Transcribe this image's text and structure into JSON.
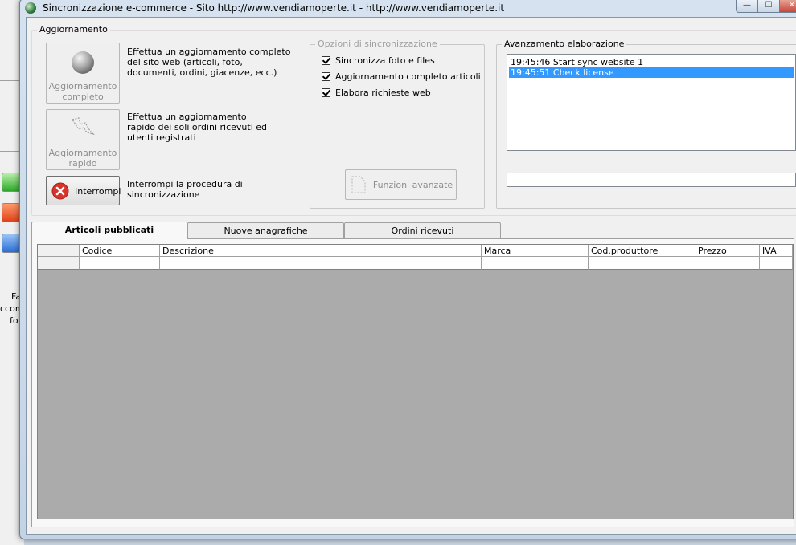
{
  "window": {
    "title": "Sincronizzazione e-commerce - Sito http://www.vendiamoperte.it - http://www.vendiamoperte.it",
    "min_glyph": "—",
    "max_glyph": "☐",
    "close_glyph": "✕"
  },
  "background_app": {
    "lines": [
      "Fa",
      "ccomp",
      "fo"
    ]
  },
  "aggiornamento": {
    "group_title": "Aggiornamento",
    "full_update": {
      "label_line1": "Aggiornamento",
      "label_line2": "completo",
      "desc_line1": "Effettua un aggiornamento completo",
      "desc_line2": "del sito web (articoli, foto,",
      "desc_line3": "documenti, ordini, giacenze, ecc.)",
      "icon": "globe-icon"
    },
    "quick_update": {
      "label_line1": "Aggiornamento",
      "label_line2": "rapido",
      "desc_line1": "Effettua un aggiornamento",
      "desc_line2": "rapido dei soli ordini ricevuti ed",
      "desc_line3": "utenti registrati",
      "icon": "lightning-icon"
    },
    "stop": {
      "label": "Interrompi",
      "desc_line1": "Interrompi la procedura di",
      "desc_line2": "sincronizzazione",
      "icon": "stop-x-icon",
      "icon_color": "#d9342b"
    }
  },
  "opzioni": {
    "group_title": "Opzioni di sincronizzazione",
    "options": [
      {
        "label": "Sincronizza foto e files",
        "checked": true
      },
      {
        "label": "Aggiornamento completo articoli",
        "checked": true
      },
      {
        "label": "Elabora richieste web",
        "checked": true
      }
    ],
    "advanced_button": "Funzioni avanzate"
  },
  "avanzamento": {
    "group_title": "Avanzamento elaborazione",
    "log": [
      {
        "text": "19:45:46 Start sync website 1",
        "selected": false
      },
      {
        "text": "19:45:51 Check license",
        "selected": true
      }
    ],
    "progress": 0
  },
  "tabs": [
    {
      "label": "Articoli pubblicati",
      "active": true
    },
    {
      "label": "Nuove anagrafiche",
      "active": false
    },
    {
      "label": "Ordini ricevuti",
      "active": false
    }
  ],
  "grid": {
    "columns": [
      "",
      "Codice",
      "Descrizione",
      "Marca",
      "Cod.produttore",
      "Prezzo",
      "IVA"
    ]
  },
  "colors": {
    "selection": "#3399ff",
    "grid_background": "#ababab"
  }
}
